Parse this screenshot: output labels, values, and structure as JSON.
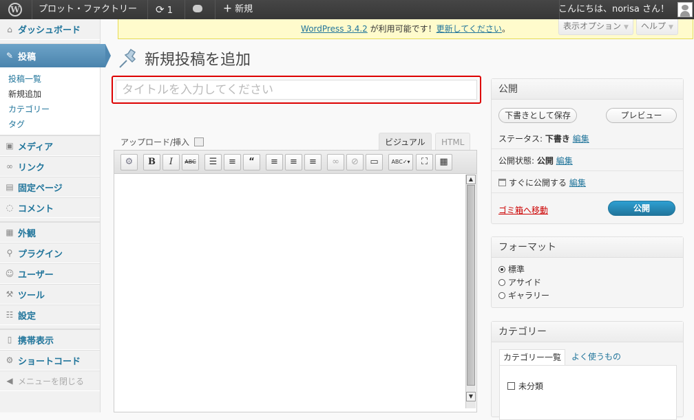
{
  "adminbar": {
    "site_name": "プロット・ファクトリー",
    "updates_count": "1",
    "new_label": "新規",
    "greeting": "こんにちは、norisa さん！"
  },
  "sidebar": {
    "dashboard": "ダッシュボード",
    "posts": "投稿",
    "posts_sub": [
      "投稿一覧",
      "新規追加",
      "カテゴリー",
      "タグ"
    ],
    "media": "メディア",
    "links": "リンク",
    "pages": "固定ページ",
    "comments": "コメント",
    "appearance": "外観",
    "plugins": "プラグイン",
    "users": "ユーザー",
    "tools": "ツール",
    "settings": "設定",
    "mobile": "携帯表示",
    "shortcode": "ショートコード",
    "collapse": "メニューを閉じる"
  },
  "notice": {
    "version_link": "WordPress 3.4.2",
    "middle": " が利用可能です！",
    "update_link": "更新してください",
    "end": "。"
  },
  "screen_options": "表示オプション",
  "help": "ヘルプ",
  "page_title": "新規投稿を追加",
  "post_title": {
    "placeholder": "タイトルを入力してください",
    "value": ""
  },
  "editor": {
    "upload_label": "アップロード/挿入",
    "tab_visual": "ビジュアル",
    "tab_html": "HTML",
    "toolbar": [
      "kitchen-sink",
      "B",
      "I",
      "ABC",
      "ul",
      "ol",
      "quote",
      "align-left",
      "align-center",
      "align-right",
      "link",
      "unlink",
      "more",
      "spellcheck",
      "fullscreen",
      "toggle"
    ]
  },
  "publish": {
    "heading": "公開",
    "save_draft": "下書きとして保存",
    "preview": "プレビュー",
    "status_label": "ステータス:",
    "status_value": "下書き",
    "visibility_label": "公開状態:",
    "visibility_value": "公開",
    "schedule_label": "すぐに公開する",
    "edit": "編集",
    "trash": "ゴミ箱へ移動",
    "publish_button": "公開"
  },
  "format": {
    "heading": "フォーマット",
    "options": [
      "標準",
      "アサイド",
      "ギャラリー"
    ],
    "selected": "標準"
  },
  "category": {
    "heading": "カテゴリー",
    "tab_all": "カテゴリー一覧",
    "tab_popular": "よく使うもの",
    "items": [
      "未分類"
    ]
  }
}
